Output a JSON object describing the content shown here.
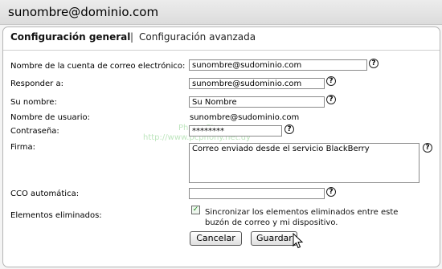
{
  "window": {
    "title": "sunombre@dominio.com"
  },
  "tabs": [
    {
      "label": "Configuración general"
    },
    {
      "label": "|"
    },
    {
      "label": "Configuración avanzada"
    }
  ],
  "form": {
    "account_name": {
      "label": "Nombre de la cuenta de correo electrónico:",
      "value": "sunombre@sudominio.com"
    },
    "reply_to": {
      "label": "Responder a:",
      "value": "sunombre@sudominio.com"
    },
    "your_name": {
      "label": "Su nombre:",
      "value": "Su Nombre"
    },
    "username": {
      "label": "Nombre de usuario:",
      "value": "sunombre@sudominio.com"
    },
    "password": {
      "label": "Contraseña:",
      "value": "********"
    },
    "signature": {
      "label": "Firma:",
      "value": "Correo enviado desde el servicio BlackBerry"
    },
    "auto_bcc": {
      "label": "CCO automática:",
      "value": ""
    },
    "deleted_items": {
      "label": "Elementos eliminados:",
      "checkbox_text": "Sincronizar los elementos eliminados entre este buzón de correo y mi dispositivo.",
      "checked": true
    }
  },
  "buttons": {
    "cancel": "Cancelar",
    "save": "Guardar"
  },
  "icons": {
    "help": "?",
    "check": "✓"
  },
  "watermark": {
    "line1": "Phone Store",
    "line2": "http://www.pcphony.net.uy"
  }
}
